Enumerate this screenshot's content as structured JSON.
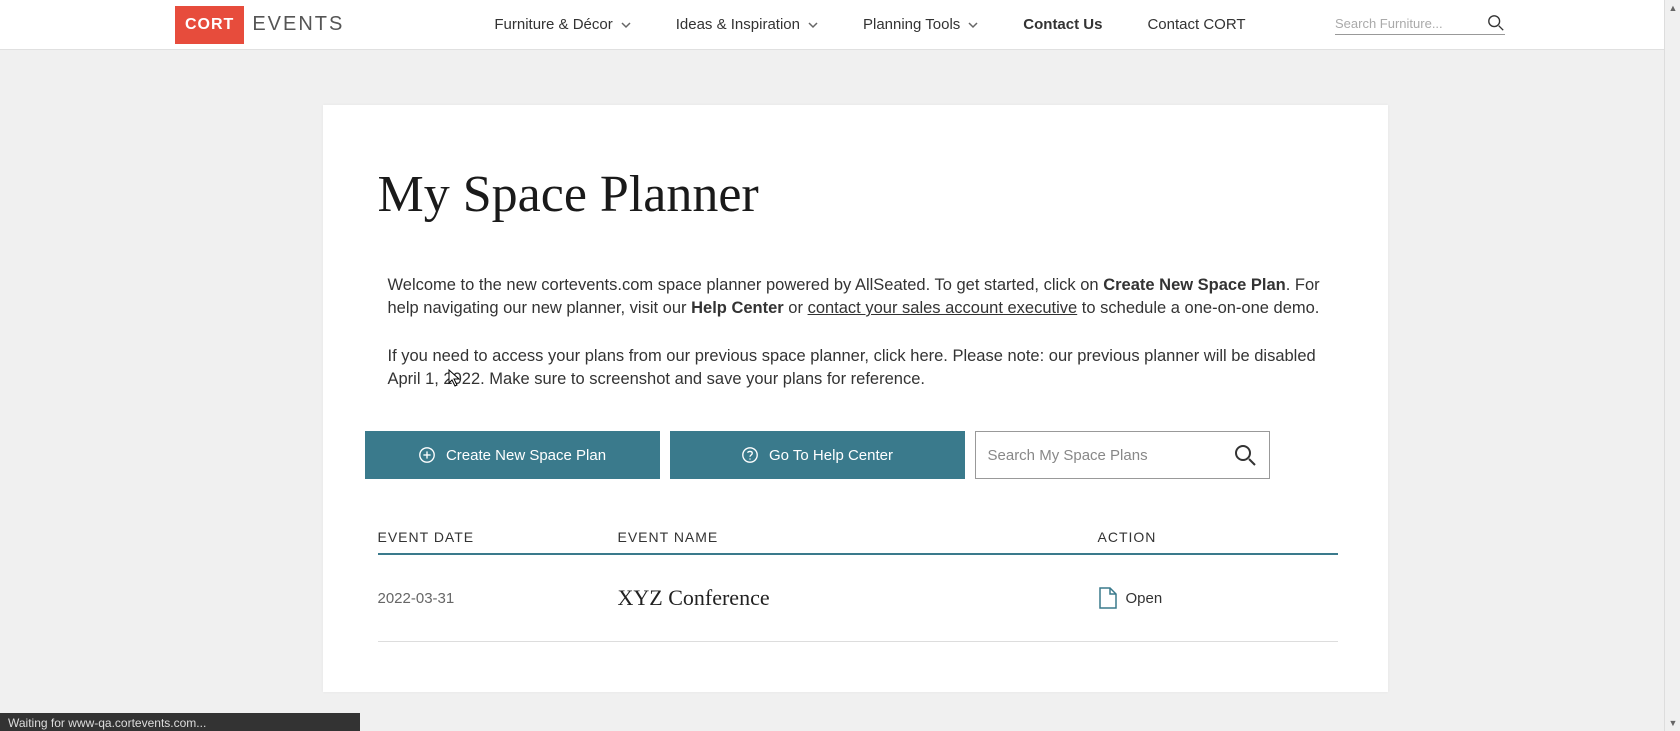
{
  "header": {
    "logo_box": "CORT",
    "logo_text": "EVENTS",
    "nav": {
      "furniture": "Furniture & Décor",
      "ideas": "Ideas & Inspiration",
      "planning": "Planning Tools",
      "contact_us": "Contact Us",
      "contact_cort": "Contact CORT"
    },
    "search_placeholder": "Search Furniture..."
  },
  "page": {
    "title": "My Space Planner",
    "intro": {
      "p1a": "Welcome to the new cortevents.com space planner powered by AllSeated.  To get started, click on ",
      "p1b": "Create New Space Plan",
      "p1c": ".  For help navigating our new planner, visit our ",
      "p1d": "Help Center",
      "p1e": " or ",
      "p1f": "contact your sales account executive",
      "p1g": " to schedule a one-on-one demo.",
      "p2": "If you need to access your plans from our previous space planner, click here.  Please note: our previous planner will be disabled April 1, 2022.  Make sure to screenshot and save your plans for reference."
    },
    "buttons": {
      "create": "Create New Space Plan",
      "help": "Go To Help Center"
    },
    "plan_search_placeholder": "Search My Space Plans",
    "table": {
      "headers": {
        "date": "EVENT DATE",
        "name": "EVENT NAME",
        "action": "ACTION"
      },
      "rows": [
        {
          "date": "2022-03-31",
          "name": "XYZ Conference",
          "action": "Open"
        }
      ]
    }
  },
  "status_bar": "Waiting for www-qa.cortevents.com..."
}
